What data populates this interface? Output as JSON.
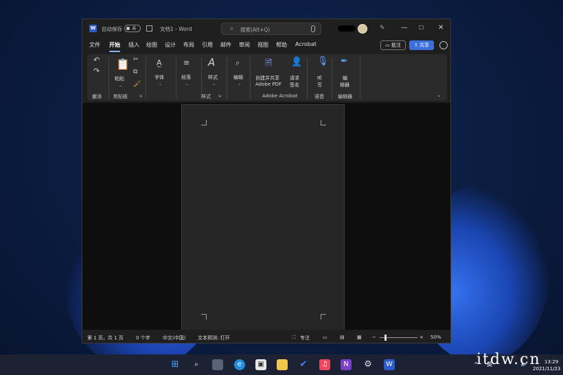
{
  "titlebar": {
    "autosave_label": "自动保存",
    "autosave_state": "关",
    "doc_title": "文档1 - Word",
    "search_placeholder": "搜索(Alt+Q)",
    "window_controls": [
      "minimize",
      "maximize",
      "close"
    ]
  },
  "tabs": [
    "文件",
    "开始",
    "插入",
    "绘图",
    "设计",
    "布局",
    "引用",
    "邮件",
    "审阅",
    "视图",
    "帮助",
    "Acrobat"
  ],
  "active_tab": "开始",
  "header_buttons": {
    "comment": "批注",
    "share": "共享"
  },
  "ribbon": {
    "undo_group": "撤消",
    "clipboard": {
      "paste": "粘贴",
      "group": "剪贴板"
    },
    "font": "字体",
    "paragraph": "段落",
    "styles": {
      "label": "样式",
      "group": "样式"
    },
    "editing": "编辑",
    "acrobat": {
      "create_pdf_line1": "创建并共享",
      "create_pdf_line2": "Adobe PDF",
      "request_sign_line1": "请求",
      "request_sign_line2": "签名",
      "group": "Adobe Acrobat"
    },
    "voice": {
      "dictate_line1": "听",
      "dictate_line2": "写",
      "group": "语音"
    },
    "editor": {
      "label_line1": "编",
      "label_line2": "辑器",
      "group": "编辑器"
    }
  },
  "statusbar": {
    "page_info": "第 1 页，共 1 页",
    "word_count": "0 个字",
    "language": "中文(中国)",
    "text_prediction": "文本预测: 打开",
    "focus": "专注",
    "zoom": "50%"
  },
  "taskbar": {
    "clock_time": "13:29",
    "clock_date": "2021/11/23",
    "ime": "英"
  },
  "watermark": "itdw.cn",
  "colors": {
    "accent": "#3b6fdc",
    "window_bg": "#1f1f1f",
    "ribbon_bg": "#2b2b2b"
  }
}
